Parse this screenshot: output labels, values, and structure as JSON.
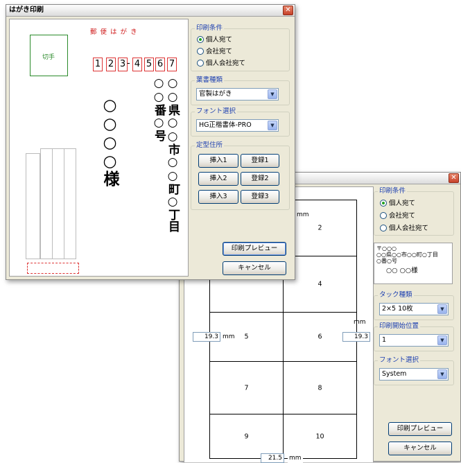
{
  "win1": {
    "title": "はがき印刷",
    "close": "✕",
    "postcard": {
      "header": "郵 便 は が き",
      "stamp": "切手",
      "zip": [
        "1",
        "2",
        "3",
        "4",
        "5",
        "6",
        "7"
      ],
      "zip_dash": "-",
      "address_col1": "○○県○○市○○町○丁目",
      "address_col2": "○○番○号",
      "name": "○○○○様"
    },
    "print_condition": {
      "title": "印刷条件",
      "options": [
        "個人宛て",
        "会社宛て",
        "個人会社宛て"
      ],
      "selected": 0
    },
    "card_type": {
      "title": "葉書種類",
      "value": "官製はがき"
    },
    "font": {
      "title": "フォント選択",
      "value": "HG正楷書体-PRO"
    },
    "fixed_address": {
      "title": "定型住所",
      "buttons": [
        [
          "挿入1",
          "登録1"
        ],
        [
          "挿入2",
          "登録2"
        ],
        [
          "挿入3",
          "登録3"
        ]
      ]
    },
    "preview_button": "印刷プレビュー",
    "cancel_button": "キャンセル"
  },
  "win2": {
    "close": "✕",
    "labels": [
      "2",
      "4",
      "5",
      "6",
      "7",
      "8",
      "9",
      "10"
    ],
    "margin_left": "19.3",
    "margin_right": "19.3",
    "margin_bottom": "21.5",
    "margin_top_unit": "mm",
    "mm": "mm",
    "print_condition": {
      "title": "印刷条件",
      "options": [
        "個人宛て",
        "会社宛て",
        "個人会社宛て"
      ],
      "selected": 0
    },
    "address_preview": {
      "line1": "〒○○○",
      "line2": "○○県○○市○○町○丁目",
      "line3": "○番○号",
      "name": "○○ ○○様"
    },
    "tack_type": {
      "title": "タック種類",
      "value": "2×5 10枚"
    },
    "start_position": {
      "title": "印刷開始位置",
      "value": "1"
    },
    "font": {
      "title": "フォント選択",
      "value": "System"
    },
    "preview_button": "印刷プレビュー",
    "cancel_button": "キャンセル"
  },
  "icons": {
    "combo_arrow": "chevron-down-icon",
    "close": "close-icon"
  }
}
